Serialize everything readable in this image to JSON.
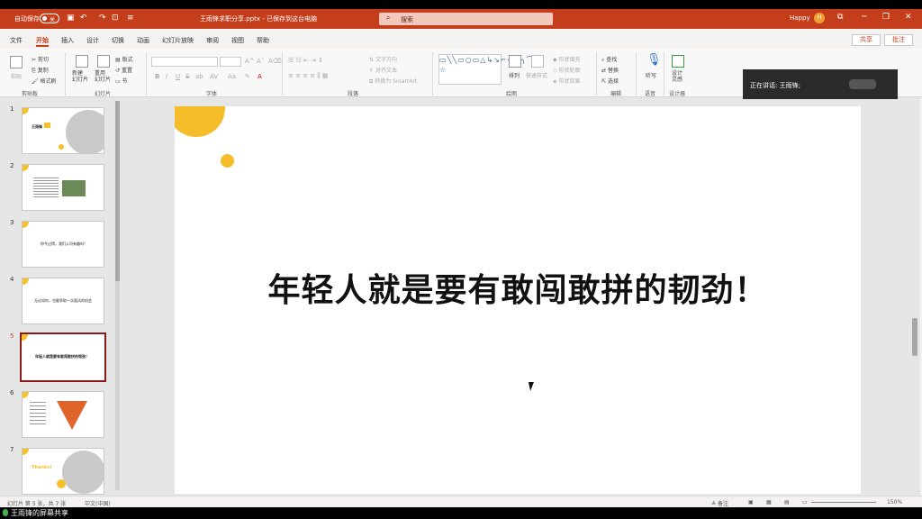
{
  "titlebar": {
    "autosave_label": "自动保存",
    "autosave_state": "关",
    "doc_title": "王雨锋求职分享.pptx - 已保存到这台电脑",
    "search_placeholder": "搜索",
    "user_name": "Happy",
    "user_initial": "H"
  },
  "tabs": [
    "文件",
    "开始",
    "插入",
    "设计",
    "切换",
    "动画",
    "幻灯片放映",
    "审阅",
    "视图",
    "帮助"
  ],
  "active_tab": "开始",
  "share_label": "共享",
  "comment_label": "批注",
  "ribbon": {
    "clipboard": {
      "paste": "粘贴",
      "cut": "剪切",
      "copy": "复制",
      "format_painter": "格式刷",
      "label": "剪贴板"
    },
    "slides": {
      "new_slide": "新建\n幻灯片",
      "reuse": "重用\n幻灯片",
      "layout": "版式",
      "reset": "重置",
      "section": "节",
      "label": "幻灯片"
    },
    "font": {
      "label": "字体",
      "buttons": [
        "B",
        "I",
        "U",
        "S",
        "ab",
        "AV",
        "Aa",
        "A"
      ]
    },
    "paragraph": {
      "text_direction": "文字方向",
      "align_text": "对齐文本",
      "smartart": "转换为 SmartArt",
      "label": "段落"
    },
    "drawing": {
      "arrange": "排列",
      "quick_styles": "快速样式",
      "fill": "形状填充",
      "outline": "形状轮廓",
      "effects": "形状效果",
      "label": "绘图"
    },
    "editing": {
      "find": "查找",
      "replace": "替换",
      "select": "选择",
      "label": "编辑"
    },
    "voice": {
      "dictate": "听写",
      "label": "语音"
    },
    "designer": {
      "design_ideas": "设计\n灵感",
      "label": "设计器"
    }
  },
  "speaker_popup": {
    "label": "正在讲话: 王雨锋;"
  },
  "thumbnails": [
    {
      "num": "1",
      "text": "王雨锋"
    },
    {
      "num": "2",
      "text": ""
    },
    {
      "num": "3",
      "text": "你今过得，我们公司有趣吗？"
    },
    {
      "num": "4",
      "text": "无论如何，也要争取一次面试的机会"
    },
    {
      "num": "5",
      "text": "年轻人就是要有敢闯敢拼的韧劲！"
    },
    {
      "num": "6",
      "text": ""
    },
    {
      "num": "7",
      "text": "Thanks!"
    }
  ],
  "active_slide": 5,
  "slide": {
    "headline": "年轻人就是要有敢闯敢拼的韧劲！"
  },
  "status": {
    "slide_info": "幻灯片 第 5 张，共 7 张",
    "language": "中文(中国)",
    "notes": "备注",
    "zoom": "150%"
  },
  "sharebar": {
    "text": "王雨锋的屏幕共享"
  },
  "colors": {
    "accent": "#c43e1c",
    "slide_accent": "#f5bd2a"
  }
}
